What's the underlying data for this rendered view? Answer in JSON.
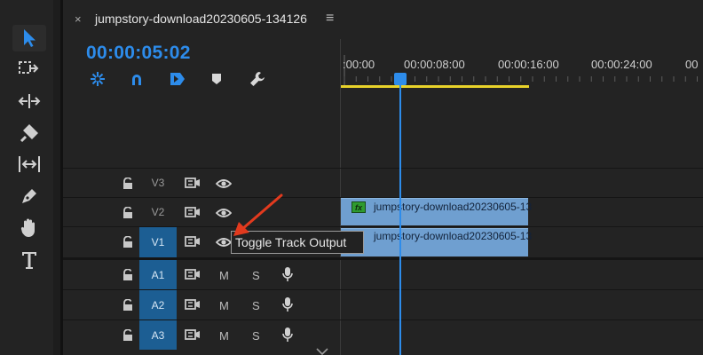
{
  "tab": {
    "title": "jumpstory-download20230605-134126",
    "close_glyph": "×",
    "menu_glyph": "≡"
  },
  "timecode": "00:00:05:02",
  "ruler": {
    "ticks": [
      ":00:00",
      "00:00:08:00",
      "00:00:16:00",
      "00:00:24:00",
      "00"
    ]
  },
  "tracks": [
    {
      "name": "V3",
      "mute": "",
      "solo": ""
    },
    {
      "name": "V2",
      "mute": "",
      "solo": ""
    },
    {
      "name": "V1",
      "mute": "",
      "solo": ""
    },
    {
      "name": "A1",
      "mute": "M",
      "solo": "S"
    },
    {
      "name": "A2",
      "mute": "M",
      "solo": "S"
    },
    {
      "name": "A3",
      "mute": "M",
      "solo": "S"
    }
  ],
  "clips": [
    {
      "label": "jumpstory-download20230605-13",
      "fx": "fx"
    },
    {
      "label": "jumpstory-download20230605-13"
    }
  ],
  "tooltip": "Toggle Track Output",
  "colors": {
    "accent": "#2d8ceb",
    "selected_track": "#1c5e93",
    "clip": "#6f9fd0",
    "workbar": "#e8d22a",
    "annotation_arrow": "#e23a1e"
  },
  "icons": {
    "tools": [
      "selection-tool-icon",
      "track-select-forward-icon",
      "ripple-edit-icon",
      "razor-icon",
      "slip-icon",
      "pen-icon",
      "hand-icon",
      "type-icon"
    ],
    "controls": [
      "snap-nest-icon",
      "linked-selection-icon",
      "add-marker-sequence-icon",
      "marker-icon",
      "wrench-icon"
    ]
  }
}
